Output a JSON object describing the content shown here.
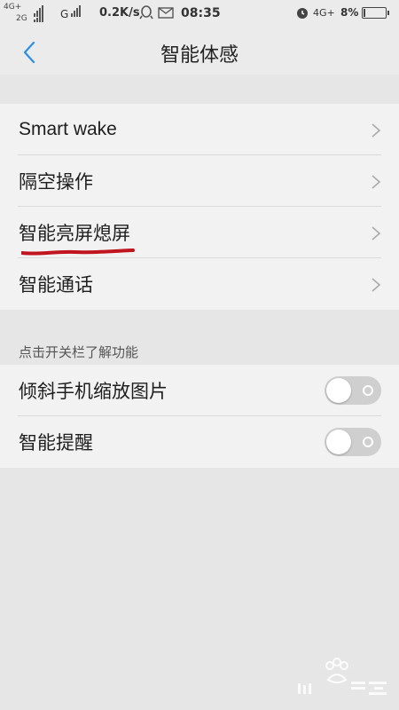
{
  "status_bar": {
    "net1": "4G+",
    "net2": "2G",
    "carrier2": "G",
    "speed": "0.2K/s",
    "time": "08:35",
    "net3": "4G+",
    "battery_text": "8%",
    "battery_level": 0.08
  },
  "header": {
    "title": "智能体感",
    "back_icon": "chevron-left-icon",
    "accent": "#2a8fe6"
  },
  "list1": {
    "items": [
      {
        "label": "Smart wake"
      },
      {
        "label": "隔空操作"
      },
      {
        "label": "智能亮屏熄屏"
      },
      {
        "label": "智能通话"
      }
    ]
  },
  "section": {
    "label": "点击开关栏了解功能"
  },
  "list2": {
    "items": [
      {
        "label": "倾斜手机缩放图片",
        "enabled": false
      },
      {
        "label": "智能提醒",
        "enabled": false
      }
    ]
  },
  "annotation": {
    "underline_color": "#c0141e"
  }
}
